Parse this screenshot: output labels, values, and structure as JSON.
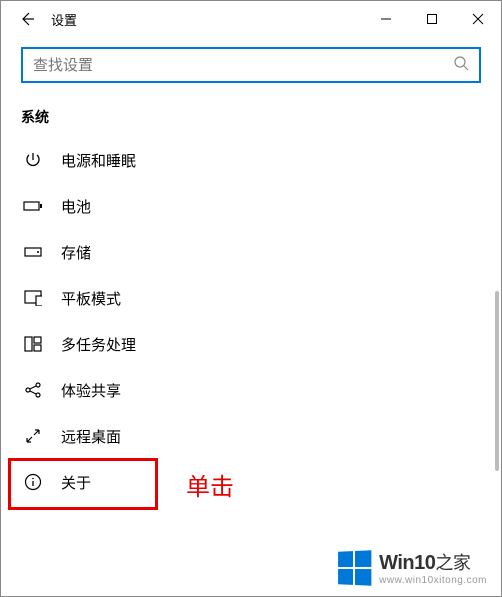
{
  "titlebar": {
    "title": "设置"
  },
  "search": {
    "placeholder": "查找设置"
  },
  "section": {
    "label": "系统"
  },
  "nav": {
    "items": [
      {
        "label": "电源和睡眠",
        "icon": "power-icon"
      },
      {
        "label": "电池",
        "icon": "battery-icon"
      },
      {
        "label": "存储",
        "icon": "storage-icon"
      },
      {
        "label": "平板模式",
        "icon": "tablet-icon"
      },
      {
        "label": "多任务处理",
        "icon": "multitask-icon"
      },
      {
        "label": "体验共享",
        "icon": "share-icon"
      },
      {
        "label": "远程桌面",
        "icon": "remote-icon"
      },
      {
        "label": "关于",
        "icon": "info-icon"
      }
    ]
  },
  "annotation": {
    "text": "单击"
  },
  "branding": {
    "name_en": "Win10",
    "name_zh": "之家",
    "url": "www.win10xitong.com"
  }
}
